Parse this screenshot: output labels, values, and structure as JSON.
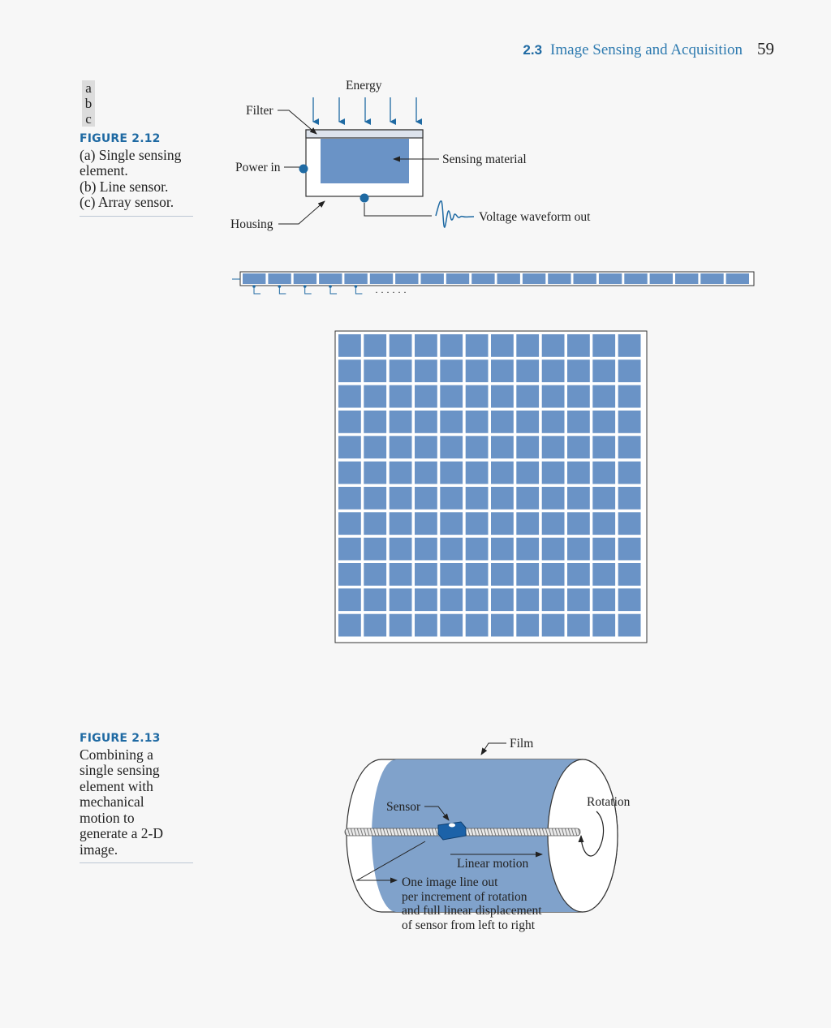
{
  "header": {
    "section_number": "2.3",
    "section_title": "Image Sensing and Acquisition",
    "page_number": "59"
  },
  "figure_2_12": {
    "panel_letters": [
      "a",
      "b",
      "c"
    ],
    "label": "FIGURE 2.12",
    "caption_lines": [
      "(a) Single sensing element.",
      "(b) Line sensor.",
      "(c) Array sensor."
    ],
    "diagram_a": {
      "energy": "Energy",
      "filter": "Filter",
      "power_in": "Power in",
      "housing": "Housing",
      "sensing_material": "Sensing material",
      "voltage_out": "Voltage waveform out"
    },
    "diagram_b": {
      "cell_count": 20,
      "ellipsis": "· · · · · ·"
    },
    "diagram_c": {
      "rows": 12,
      "cols": 12
    }
  },
  "figure_2_13": {
    "label": "FIGURE 2.13",
    "caption_lines": [
      "Combining a",
      "single sensing",
      "element with",
      "mechanical",
      "motion to",
      "generate a 2-D",
      "image."
    ],
    "film": "Film",
    "sensor": "Sensor",
    "rotation": "Rotation",
    "linear_motion": "Linear motion",
    "note_lines": [
      "One image line out",
      "per increment of rotation",
      "and full linear displacement",
      "of sensor from left to right"
    ]
  },
  "colors": {
    "accent": "#1f6aa3",
    "sensor_fill": "#6a93c6",
    "film_fill": "#80a2cb",
    "sensor_block": "#1c62a8"
  }
}
